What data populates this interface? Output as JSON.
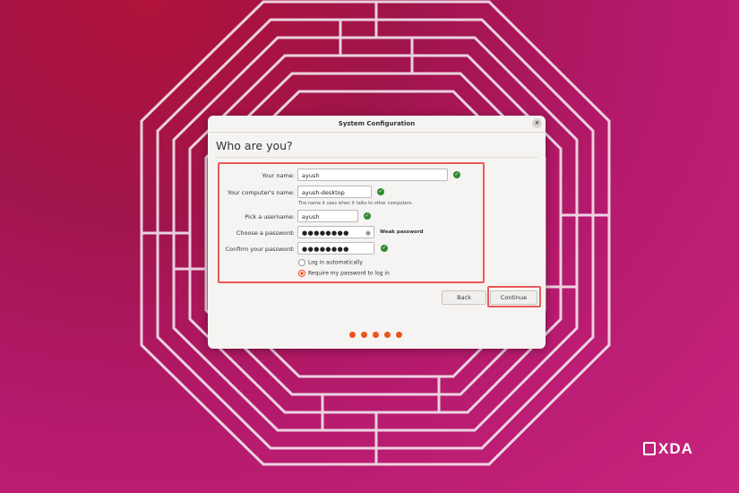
{
  "window": {
    "title": "System Configuration",
    "close_icon": "×"
  },
  "page": {
    "heading": "Who are you?"
  },
  "form": {
    "name": {
      "label": "Your name:",
      "value": "ayush"
    },
    "computer": {
      "label": "Your computer's name:",
      "value": "ayush-desktop",
      "hint": "The name it uses when it talks to other computers."
    },
    "username": {
      "label": "Pick a username:",
      "value": "ayush"
    },
    "password": {
      "label": "Choose a password:",
      "value": "●●●●●●●●",
      "strength": "Weak password"
    },
    "confirm": {
      "label": "Confirm your password:",
      "value": "●●●●●●●●"
    },
    "login_options": [
      {
        "label": "Log in automatically",
        "selected": false
      },
      {
        "label": "Require my password to log in",
        "selected": true
      }
    ]
  },
  "buttons": {
    "back": "Back",
    "continue": "Continue"
  },
  "progress": {
    "total": 5,
    "current": 5
  },
  "watermark": {
    "text": "XDA"
  },
  "colors": {
    "accent": "#e95420",
    "highlight": "#e85a5a",
    "check": "#2f8a2f"
  }
}
